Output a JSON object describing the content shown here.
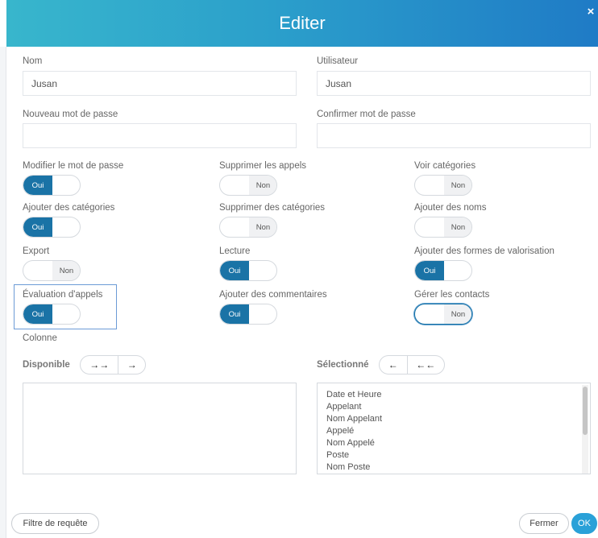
{
  "dialog": {
    "title": "Editer",
    "close_glyph": "×"
  },
  "fields": {
    "nom_label": "Nom",
    "nom_value": "Jusan",
    "utilisateur_label": "Utilisateur",
    "utilisateur_value": "Jusan",
    "nouveau_mdp_label": "Nouveau mot de passe",
    "confirmer_mdp_label": "Confirmer mot de passe"
  },
  "toggles": [
    {
      "label": "Modifier le mot de passe",
      "state": "Oui"
    },
    {
      "label": "Supprimer les appels",
      "state": "Non"
    },
    {
      "label": "Voir catégories",
      "state": "Non"
    },
    {
      "label": "Ajouter des catégories",
      "state": "Oui"
    },
    {
      "label": "Supprimer des catégories",
      "state": "Non"
    },
    {
      "label": "Ajouter des noms",
      "state": "Non"
    },
    {
      "label": "Export",
      "state": "Non"
    },
    {
      "label": "Lecture",
      "state": "Oui"
    },
    {
      "label": "Ajouter des formes de valorisation",
      "state": "Oui"
    },
    {
      "label": "Évaluation d'appels",
      "state": "Oui"
    },
    {
      "label": "Ajouter des commentaires",
      "state": "Oui"
    },
    {
      "label": "Gérer les contacts",
      "state": "Non"
    }
  ],
  "columns": {
    "title": "Colonne",
    "available_label": "Disponible",
    "selected_label": "Sélectionné",
    "add_all_glyph": "→→",
    "add_one_glyph": "→",
    "remove_one_glyph": "←",
    "remove_all_glyph": "←←",
    "selected_items": [
      "Date et Heure",
      "Appelant",
      "Nom Appelant",
      "Appelé",
      "Nom Appelé",
      "Poste",
      "Nom Poste"
    ]
  },
  "footer": {
    "filter_button": "Filtre de requête",
    "close_button": "Fermer",
    "ok_button": "OK"
  },
  "colors": {
    "header_gradient_start": "#38b6cc",
    "header_gradient_end": "#1f7bc6",
    "toggle_on": "#1a73a6",
    "ok_button": "#2aa1d8"
  }
}
